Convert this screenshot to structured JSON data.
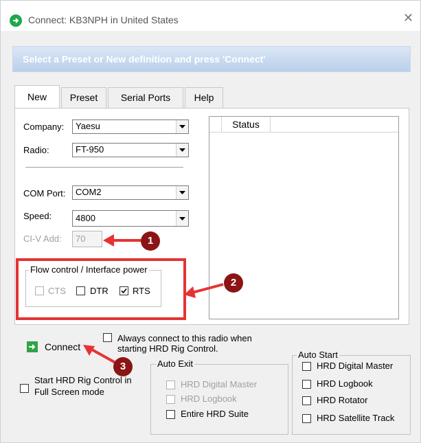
{
  "window": {
    "title": "Connect: KB3NPH in United States",
    "close_glyph": "✕"
  },
  "banner": {
    "text": "Select a Preset or New definition and press 'Connect'"
  },
  "tabs": [
    {
      "label": "New",
      "active": true
    },
    {
      "label": "Preset",
      "active": false
    },
    {
      "label": "Serial Ports",
      "active": false
    },
    {
      "label": "Help",
      "active": false
    }
  ],
  "form": {
    "company_label": "Company:",
    "company_value": "Yaesu",
    "radio_label": "Radio:",
    "radio_value": "FT-950",
    "com_label": "COM Port:",
    "com_value": "COM2",
    "speed_label": "Speed:",
    "speed_value": "4800",
    "civ_label": "CI-V Add:",
    "civ_value": "70"
  },
  "flow_control": {
    "title": "Flow control / Interface power",
    "items": [
      {
        "label": "CTS",
        "checked": false,
        "enabled": false
      },
      {
        "label": "DTR",
        "checked": false,
        "enabled": true
      },
      {
        "label": "RTS",
        "checked": true,
        "enabled": true
      }
    ]
  },
  "status": {
    "column_label": "Status"
  },
  "connect": {
    "button_label": "Connect",
    "always_connect_line1": "Always connect to this radio when",
    "always_connect_line2": "starting HRD Rig Control.",
    "fullscreen_line1": "Start HRD Rig Control in",
    "fullscreen_line2": "Full Screen mode"
  },
  "auto_exit": {
    "title": "Auto Exit",
    "items": [
      {
        "label": "HRD Digital Master",
        "checked": false,
        "enabled": false
      },
      {
        "label": "HRD Logbook",
        "checked": false,
        "enabled": false
      },
      {
        "label": "Entire HRD Suite",
        "checked": false,
        "enabled": true
      }
    ]
  },
  "auto_start": {
    "title": "Auto Start",
    "items": [
      {
        "label": "HRD Digital Master",
        "checked": false
      },
      {
        "label": "HRD Logbook",
        "checked": false
      },
      {
        "label": "HRD Rotator",
        "checked": false
      },
      {
        "label": "HRD Satellite Track",
        "checked": false
      }
    ]
  },
  "annotations": {
    "marker1": "1",
    "marker2": "2",
    "marker3": "3"
  },
  "colors": {
    "annotation_red": "#e53333",
    "marker_fill": "#8b1414",
    "banner_blue": "#b9cfeb",
    "go_green": "#2ea446"
  }
}
